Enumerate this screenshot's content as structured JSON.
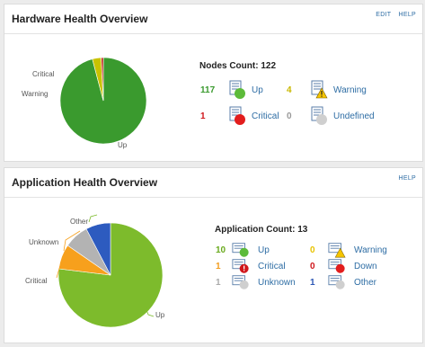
{
  "hardware": {
    "title": "Hardware Health Overview",
    "links": [
      "EDIT",
      "HELP"
    ],
    "pie_labels": {
      "critical": "Critical",
      "warning": "Warning",
      "up": "Up"
    },
    "count_title": "Nodes Count: 122",
    "statuses": [
      {
        "count": "117",
        "label": "Up",
        "color": "#3a9a2e"
      },
      {
        "count": "4",
        "label": "Warning",
        "color": "#c9b800"
      },
      {
        "count": "1",
        "label": "Critical",
        "color": "#d0161b"
      },
      {
        "count": "0",
        "label": "Undefined",
        "color": "#999999"
      }
    ]
  },
  "application": {
    "title": "Application Health Overview",
    "links": [
      "HELP"
    ],
    "pie_labels": {
      "other": "Other",
      "unknown": "Unknown",
      "critical": "Critical",
      "up": "Up"
    },
    "count_title": "Application Count: 13",
    "statuses": [
      {
        "count": "10",
        "label": "Up",
        "color": "#6aaa1e"
      },
      {
        "count": "0",
        "label": "Warning",
        "color": "#e8c300"
      },
      {
        "count": "1",
        "label": "Critical",
        "color": "#f29b1d"
      },
      {
        "count": "0",
        "label": "Down",
        "color": "#d0161b"
      },
      {
        "count": "1",
        "label": "Unknown",
        "color": "#aaaaaa"
      },
      {
        "count": "1",
        "label": "Other",
        "color": "#2c57b5"
      }
    ]
  },
  "chart_data": [
    {
      "type": "pie",
      "categories": [
        "Up",
        "Warning",
        "Critical",
        "Undefined"
      ],
      "values": [
        117,
        4,
        1,
        0
      ],
      "colors": [
        "#3a9a2e",
        "#c9c200",
        "#c0281c",
        "#bbbbbb"
      ]
    },
    {
      "type": "pie",
      "categories": [
        "Up",
        "Critical",
        "Unknown",
        "Other"
      ],
      "values": [
        10,
        1,
        1,
        1
      ],
      "colors": [
        "#7dbb2c",
        "#f7a01c",
        "#b3b3b3",
        "#2d5bbf"
      ]
    }
  ]
}
